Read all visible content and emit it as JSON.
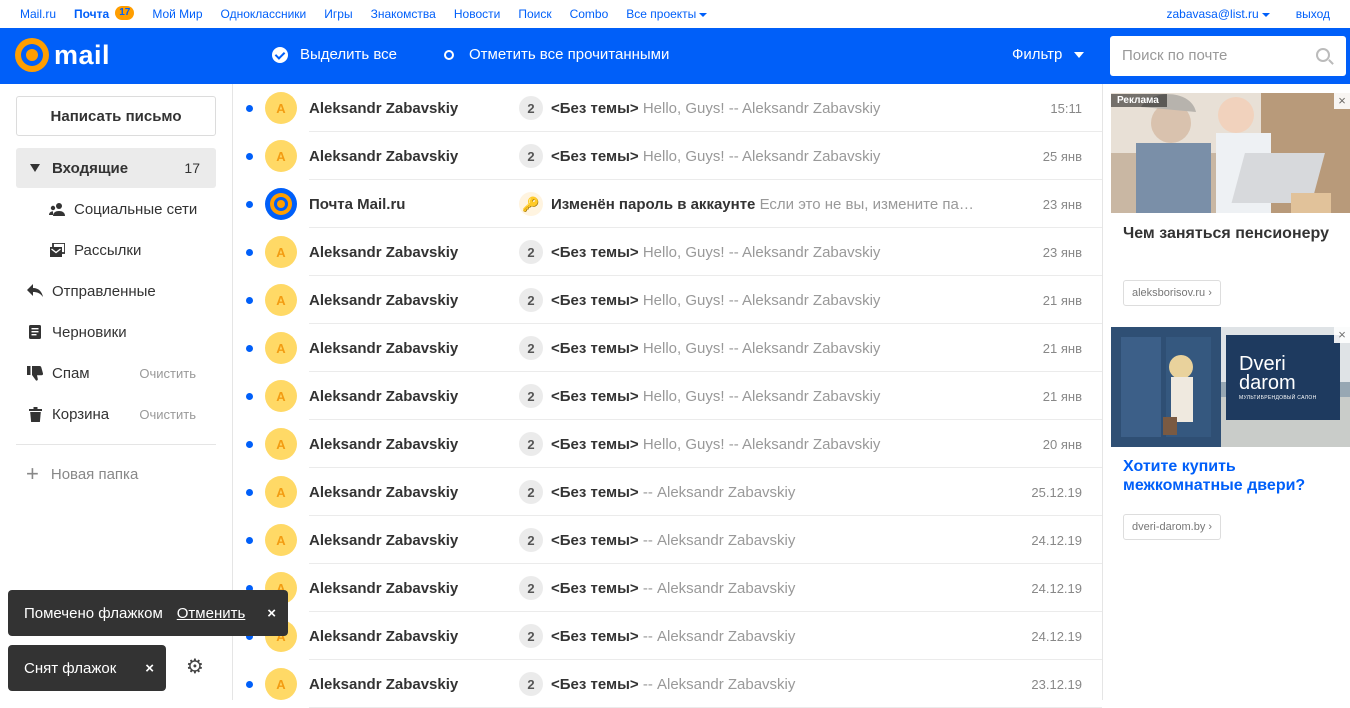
{
  "portal": {
    "links": [
      "Mail.ru",
      "Почта",
      "Мой Мир",
      "Одноклассники",
      "Игры",
      "Знакомства",
      "Новости",
      "Поиск",
      "Combo",
      "Все проекты"
    ],
    "mail_badge": "17",
    "user_email": "zabavasa@list.ru",
    "logout": "выход"
  },
  "header": {
    "logo_text": "mail",
    "select_all": "Выделить все",
    "mark_all_read": "Отметить все прочитанными",
    "filter": "Фильтр",
    "search_placeholder": "Поиск по почте"
  },
  "sidebar": {
    "compose": "Написать письмо",
    "inbox": "Входящие",
    "inbox_count": "17",
    "social": "Социальные сети",
    "newsletters": "Рассылки",
    "sent": "Отправленные",
    "drafts": "Черновики",
    "spam": "Спам",
    "trash": "Корзина",
    "clear": "Очистить",
    "new_folder": "Новая папка"
  },
  "toasts": {
    "flagged": "Помечено флажком",
    "undo": "Отменить",
    "unflagged": "Снят флажок",
    "close": "×"
  },
  "messages": [
    {
      "sender": "Aleksandr Zabavskiy",
      "avatar": "A",
      "thread": "2",
      "subject": "<Без темы>",
      "snippet": "Hello, Guys! -- Aleksandr Zabavskiy",
      "date": "15:11"
    },
    {
      "sender": "Aleksandr Zabavskiy",
      "avatar": "A",
      "thread": "2",
      "subject": "<Без темы>",
      "snippet": "Hello, Guys! -- Aleksandr Zabavskiy",
      "date": "25 янв"
    },
    {
      "sender": "Почта Mail.ru",
      "avatar": "@",
      "thread": "",
      "subject": "Изменён пароль в аккаунте",
      "snippet": "Если это не вы, измените па…",
      "date": "23 янв"
    },
    {
      "sender": "Aleksandr Zabavskiy",
      "avatar": "A",
      "thread": "2",
      "subject": "<Без темы>",
      "snippet": "Hello, Guys! -- Aleksandr Zabavskiy",
      "date": "23 янв"
    },
    {
      "sender": "Aleksandr Zabavskiy",
      "avatar": "A",
      "thread": "2",
      "subject": "<Без темы>",
      "snippet": "Hello, Guys! -- Aleksandr Zabavskiy",
      "date": "21 янв"
    },
    {
      "sender": "Aleksandr Zabavskiy",
      "avatar": "A",
      "thread": "2",
      "subject": "<Без темы>",
      "snippet": "Hello, Guys! -- Aleksandr Zabavskiy",
      "date": "21 янв"
    },
    {
      "sender": "Aleksandr Zabavskiy",
      "avatar": "A",
      "thread": "2",
      "subject": "<Без темы>",
      "snippet": "Hello, Guys! -- Aleksandr Zabavskiy",
      "date": "21 янв"
    },
    {
      "sender": "Aleksandr Zabavskiy",
      "avatar": "A",
      "thread": "2",
      "subject": "<Без темы>",
      "snippet": "Hello, Guys! -- Aleksandr Zabavskiy",
      "date": "20 янв"
    },
    {
      "sender": "Aleksandr Zabavskiy",
      "avatar": "A",
      "thread": "2",
      "subject": "<Без темы>",
      "snippet": "-- Aleksandr Zabavskiy",
      "date": "25.12.19"
    },
    {
      "sender": "Aleksandr Zabavskiy",
      "avatar": "A",
      "thread": "2",
      "subject": "<Без темы>",
      "snippet": "-- Aleksandr Zabavskiy",
      "date": "24.12.19"
    },
    {
      "sender": "Aleksandr Zabavskiy",
      "avatar": "A",
      "thread": "2",
      "subject": "<Без темы>",
      "snippet": "-- Aleksandr Zabavskiy",
      "date": "24.12.19"
    },
    {
      "sender": "Aleksandr Zabavskiy",
      "avatar": "A",
      "thread": "2",
      "subject": "<Без темы>",
      "snippet": "-- Aleksandr Zabavskiy",
      "date": "24.12.19"
    },
    {
      "sender": "Aleksandr Zabavskiy",
      "avatar": "A",
      "thread": "2",
      "subject": "<Без темы>",
      "snippet": "-- Aleksandr Zabavskiy",
      "date": "23.12.19"
    }
  ],
  "ads": {
    "label": "Реклама",
    "ad1_title": "Чем заняться пенсионеру",
    "ad1_domain": "aleksborisov.ru",
    "ad2_title": "Хотите купить межкомнатные двери?",
    "ad2_domain": "dveri-darom.by",
    "ad2_logo_line1": "Dveri",
    "ad2_logo_line2": "darom",
    "ad2_logo_sub": "МУЛЬТИБРЕНДОВЫЙ САЛОН"
  },
  "colors": {
    "brand_blue": "#005ff9",
    "brand_orange": "#ff9e00",
    "avatar_yellow": "#ffd966"
  }
}
